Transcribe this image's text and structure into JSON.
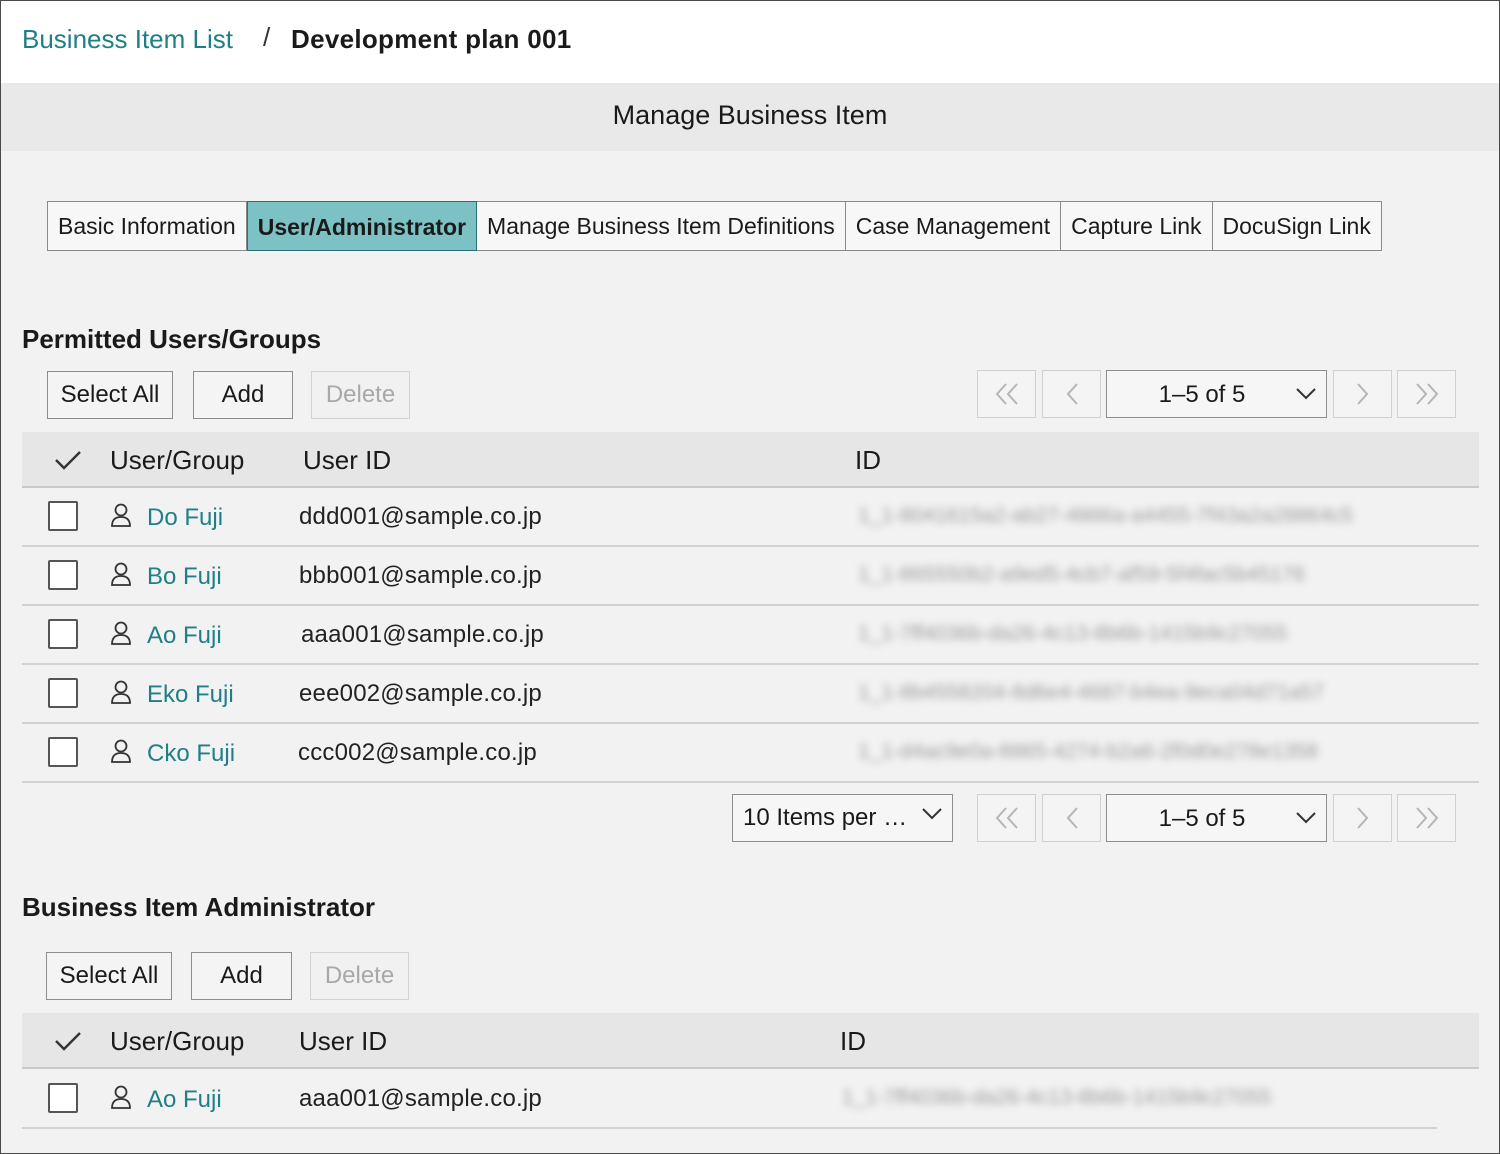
{
  "breadcrumb": {
    "parent": "Business Item List",
    "separator": "/",
    "current": "Development plan 001"
  },
  "page_title": "Manage Business Item",
  "tabs": [
    {
      "label": "Basic Information",
      "active": false
    },
    {
      "label": "User/Administrator",
      "active": true
    },
    {
      "label": "Manage Business Item Definitions",
      "active": false
    },
    {
      "label": "Case Management",
      "active": false
    },
    {
      "label": "Capture Link",
      "active": false
    },
    {
      "label": "DocuSign Link",
      "active": false
    }
  ],
  "permitted": {
    "title": "Permitted Users/Groups",
    "buttons": {
      "select_all": "Select All",
      "add": "Add",
      "delete": "Delete"
    },
    "pagination_top": {
      "range": "1–5 of 5"
    },
    "columns": {
      "user_group": "User/Group",
      "user_id": "User ID",
      "id": "ID"
    },
    "rows": [
      {
        "name": "Do Fuji",
        "user_id": "ddd001@sample.co.jp",
        "id": "1_1-8041615a2-ab27-4866a-a4455-7f43a2a28864c5"
      },
      {
        "name": "Bo Fuji",
        "user_id": "bbb001@sample.co.jp",
        "id": "1_1-865550b2-a9ed5-4cb7-af59-5f4fac5b45176"
      },
      {
        "name": "Ao Fuji",
        "user_id": "aaa001@sample.co.jp",
        "id": "1_1-7ff4036b-da26-4c13-8b6b-1415b9c27055"
      },
      {
        "name": "Eko Fuji",
        "user_id": "eee002@sample.co.jp",
        "id": "1_1-8b4558204-8d6e4-4687-b4ea-9eca04d71a57"
      },
      {
        "name": "Cko Fuji",
        "user_id": "ccc002@sample.co.jp",
        "id": "1_1-d4ac9e0a-8865-4274-b2a6-2f0d0e278e1358"
      }
    ],
    "items_per_page": "10 Items per …",
    "pagination_bottom": {
      "range": "1–5 of 5"
    }
  },
  "admin": {
    "title": "Business Item Administrator",
    "buttons": {
      "select_all": "Select All",
      "add": "Add",
      "delete": "Delete"
    },
    "columns": {
      "user_group": "User/Group",
      "user_id": "User ID",
      "id": "ID"
    },
    "rows": [
      {
        "name": "Ao Fuji",
        "user_id": "aaa001@sample.co.jp",
        "id": "1_1-7ff4036b-da26-4c13-8b6b-1415b9c27055"
      }
    ]
  },
  "colors": {
    "accent_teal": "#1f7f86",
    "active_tab": "#7cc2c4",
    "title_bar": "#e9e9e9"
  },
  "icons": [
    "check-icon",
    "person-icon",
    "chevron-down-icon",
    "double-chevron-left-icon",
    "chevron-left-icon",
    "chevron-right-icon",
    "double-chevron-right-icon"
  ]
}
